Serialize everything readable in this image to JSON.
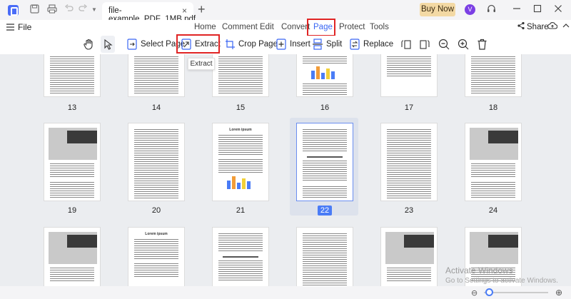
{
  "titlebar": {
    "tab_title": "file-example_PDF_1MB.pdf",
    "tab_close": "×",
    "new_tab": "+",
    "buy_now": "Buy Now",
    "avatar_initial": "V"
  },
  "menu": {
    "file": "File",
    "items": [
      "Home",
      "Comment",
      "Edit",
      "Convert",
      "Page",
      "Protect",
      "Tools"
    ],
    "active": "Page",
    "share": "Share"
  },
  "toolbar": {
    "select_page": "Select Page",
    "extract": "Extract",
    "crop_page": "Crop Page",
    "insert": "Insert",
    "split": "Split",
    "replace": "Replace",
    "tooltip": "Extract"
  },
  "pages": {
    "row1": [
      "13",
      "14",
      "15",
      "16",
      "17",
      "18"
    ],
    "row2": [
      "19",
      "20",
      "21",
      "22",
      "23",
      "24"
    ],
    "row2_headings": {
      "p21": "Lorem ipsum"
    },
    "row3_headings": {
      "p26": "Lorem ipsum"
    },
    "selected": "22"
  },
  "watermark": {
    "line1": "Activate Windows",
    "line2": "Go to Settings to activate Windows."
  },
  "colors": {
    "accent": "#4a7cf6",
    "highlight": "#e02424",
    "buy_now_bg": "#f3d9a4"
  }
}
